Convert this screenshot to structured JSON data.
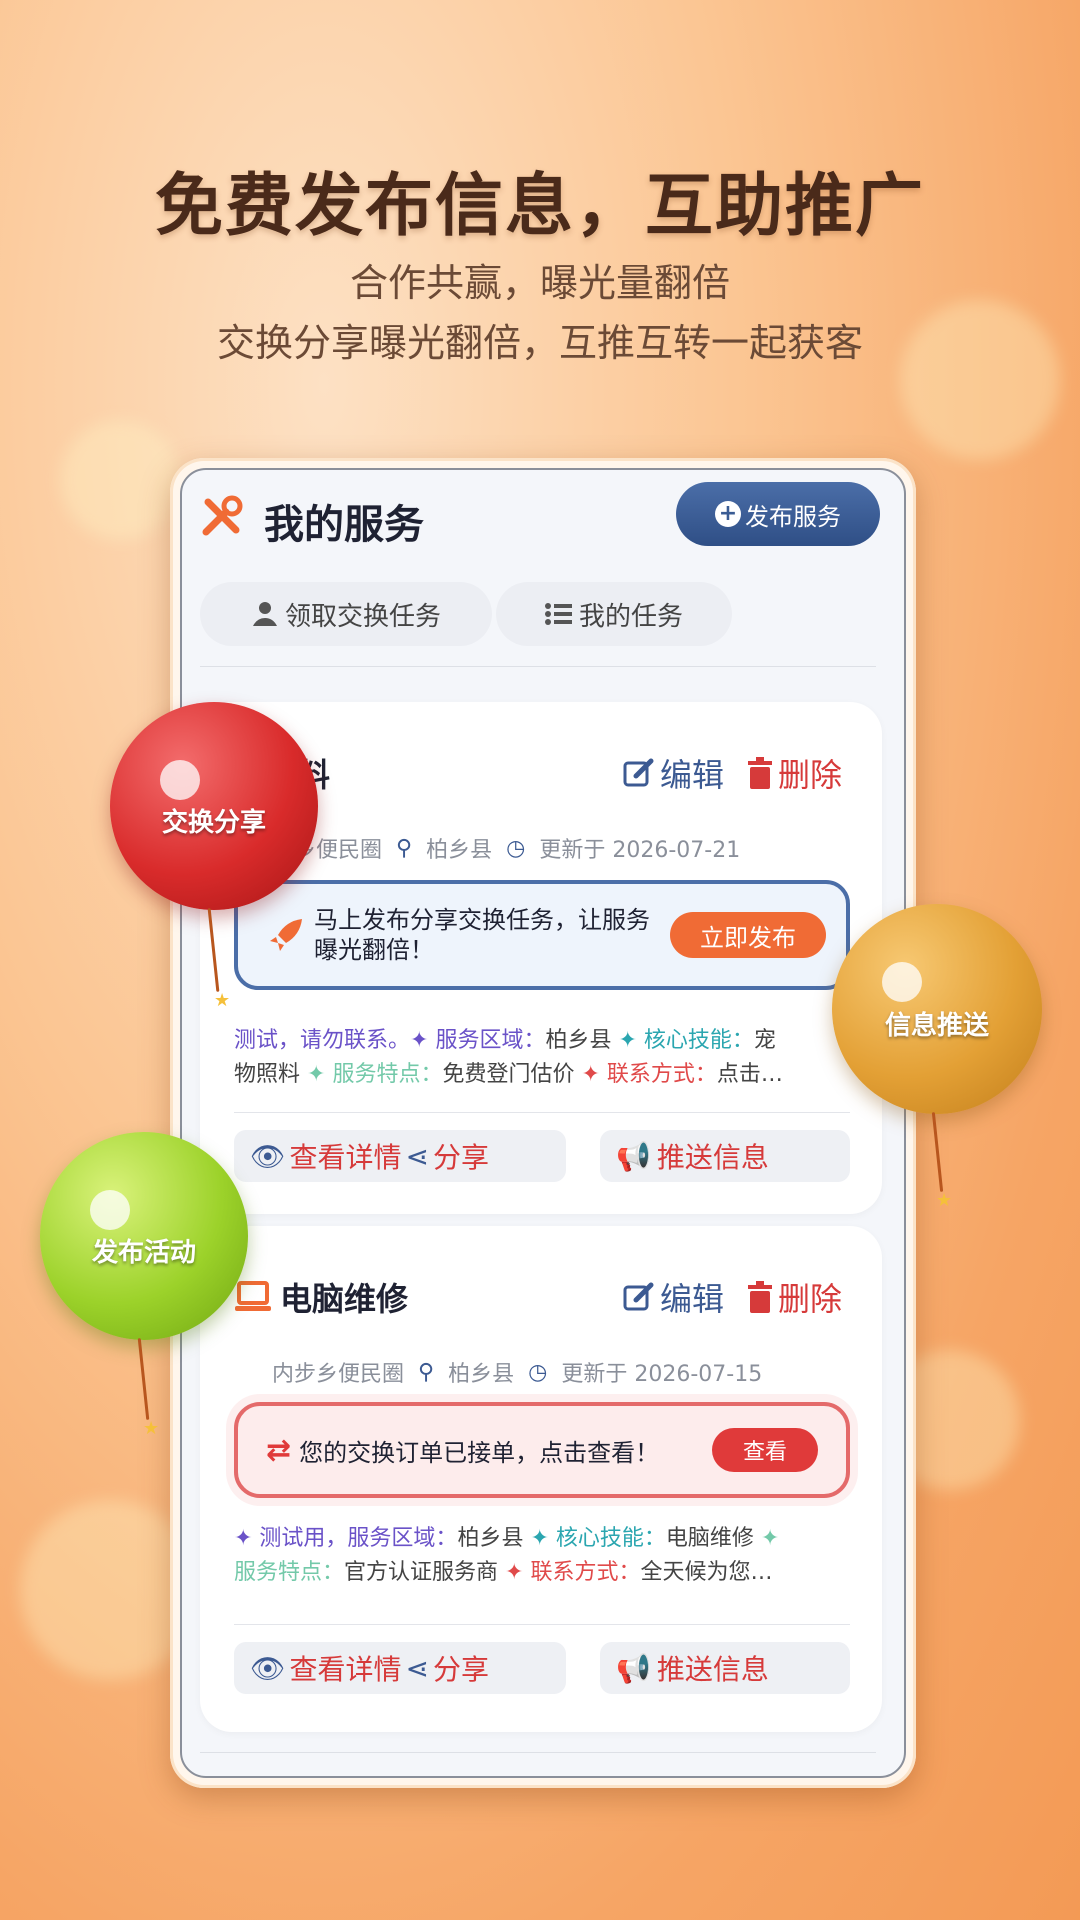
{
  "header": {
    "headline": "免费发布信息，互助推广",
    "subline1": "合作共赢，曝光量翻倍",
    "subline2": "交换分享曝光翻倍，互推互转一起获客"
  },
  "app": {
    "title": "我的服务",
    "publish_button": "发布服务",
    "tabs": [
      {
        "label": "领取交换任务",
        "icon": "user-hand-icon"
      },
      {
        "label": "我的任务",
        "icon": "list-icon"
      }
    ]
  },
  "cards": [
    {
      "title": "物照料",
      "icon": "paw-icon",
      "edit_label": "编辑",
      "delete_label": "删除",
      "area": "步乡便民圈",
      "county": "柏乡县",
      "updated": "更新于 2026-07-21",
      "promo_text": "马上发布分享交换任务，让服务曝光翻倍！",
      "promo_button": "立即发布",
      "desc_line1": [
        "测试，请勿联系。",
        "✦ 服务区域：",
        "柏乡县",
        "✦ 核心技能：",
        "宠"
      ],
      "desc_line2": [
        "物照料",
        "✦ 服务特点：",
        "免费登门估价",
        "✦ 联系方式：",
        "点击…"
      ],
      "view_label": "查看详情",
      "share_label": "分享",
      "push_label": "推送信息"
    },
    {
      "title": "电脑维修",
      "icon": "laptop-icon",
      "edit_label": "编辑",
      "delete_label": "删除",
      "area": "内步乡便民圈",
      "county": "柏乡县",
      "updated": "更新于 2026-07-15",
      "notice_text": "您的交换订单已接单，点击查看！",
      "notice_button": "查看",
      "desc_line1": [
        "✦ 测试用，服务区域：",
        "柏乡县",
        "✦ 核心技能：",
        "电脑维修",
        "✦"
      ],
      "desc_line2": [
        "服务特点：",
        "官方认证服务商",
        "✦ 联系方式：",
        "全天候为您…"
      ],
      "view_label": "查看详情",
      "share_label": "分享",
      "push_label": "推送信息"
    }
  ],
  "balloons": [
    {
      "label": "交换分享",
      "color": "#d92b2b"
    },
    {
      "label": "信息推送",
      "color": "#e3a035"
    },
    {
      "label": "发布活动",
      "color": "#9cd22a"
    }
  ],
  "colors": {
    "accent": "#3c5a92",
    "danger": "#d63a3a",
    "promo": "#f06b35"
  }
}
